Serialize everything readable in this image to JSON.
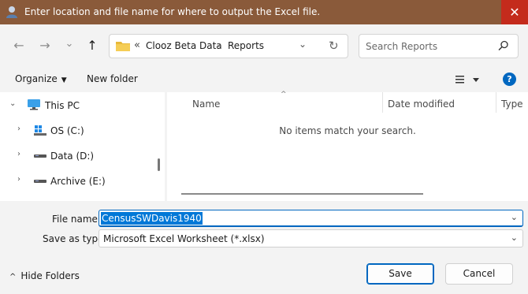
{
  "window": {
    "title": "Enter location and file name for where to output the Excel file.",
    "close_label": "✕",
    "titlebar_color": "#8a5a3a",
    "close_color": "#c42b1c"
  },
  "nav": {
    "back_icon": "←",
    "forward_icon": "→",
    "recent_icon": "⌄",
    "up_icon": "↑"
  },
  "address": {
    "overflow": "«",
    "crumbs": [
      "Clooz Beta Data",
      "Reports"
    ],
    "separator": "›",
    "dropdown_icon": "⌄",
    "refresh_icon": "↻"
  },
  "search": {
    "placeholder": "Search Reports"
  },
  "commands": {
    "organize": "Organize",
    "new_folder": "New folder",
    "help_icon": "?"
  },
  "tree": {
    "expanded_icon": "⌄",
    "collapsed_icon": "›",
    "items": [
      {
        "label": "This PC"
      },
      {
        "label": "OS (C:)"
      },
      {
        "label": "Data (D:)"
      },
      {
        "label": "Archive (E:)"
      }
    ]
  },
  "file_list": {
    "columns": [
      "Name",
      "Date modified",
      "Type"
    ],
    "sort_icon": "^",
    "empty_message": "No items match your search."
  },
  "form": {
    "file_name_label": "File name:",
    "file_name_value": "CensusSWDavis1940",
    "save_type_label": "Save as type:",
    "save_type_value": "Microsoft Excel Worksheet (*.xlsx)",
    "dropdown_icon": "⌄"
  },
  "footer": {
    "hide_folders": "Hide Folders",
    "hide_folders_icon": "^",
    "save": "Save",
    "cancel": "Cancel"
  },
  "accent_color": "#0067c0"
}
